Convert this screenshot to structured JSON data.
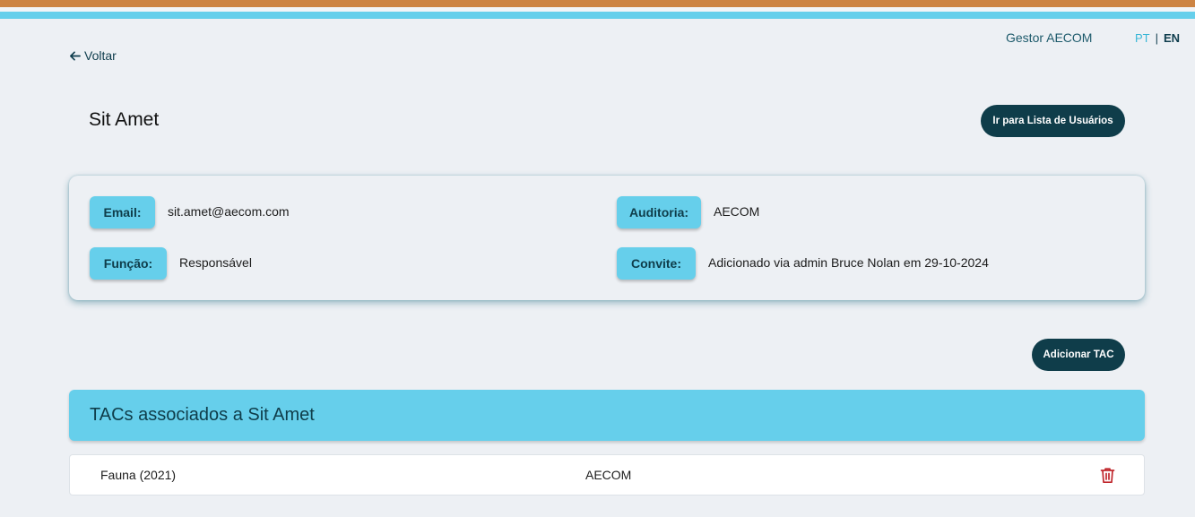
{
  "colors": {
    "orange": "#cd8443",
    "accent": "#66cfeb",
    "dark": "#0f3d4a",
    "delete": "#c0272d"
  },
  "header": {
    "back_label": "Voltar",
    "user_label": "Gestor AECOM",
    "lang_pt": "PT",
    "lang_sep": "|",
    "lang_en": "EN"
  },
  "page": {
    "title": "Sit Amet",
    "users_button": "Ir para Lista de Usuários"
  },
  "details": {
    "email_label": "Email:",
    "email_value": "sit.amet@aecom.com",
    "auditoria_label": "Auditoria:",
    "auditoria_value": "AECOM",
    "funcao_label": "Função:",
    "funcao_value": "Responsável",
    "convite_label": "Convite:",
    "convite_value": "Adicionado via admin Bruce Nolan em 29-10-2024"
  },
  "tacs": {
    "add_button": "Adicionar TAC",
    "section_title": "TACs associados a Sit Amet",
    "rows": [
      {
        "name": "Fauna (2021)",
        "auditoria": "AECOM",
        "action_icon": "trash-icon"
      }
    ]
  }
}
